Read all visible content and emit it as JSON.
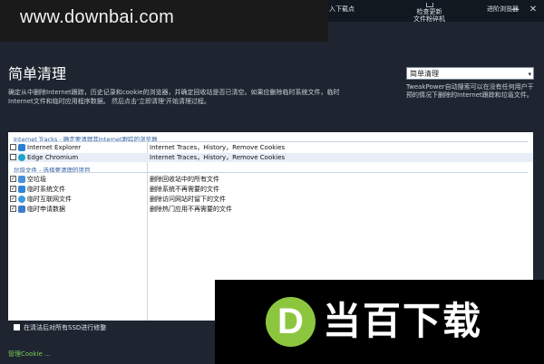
{
  "watermark": "www.downbai.com",
  "titlebar": {
    "partial_label": "入下载点",
    "check_update": "检查更新",
    "file_shredder": "文件粉碎机",
    "advanced_view": "进阶浏览器",
    "minimize": "—",
    "close": "✕"
  },
  "page": {
    "title": "简单清理",
    "description": "确定从中删除Internet跟踪，历史记录和cookie的浏览器，并确定回收站是否已清空。如果应删除临时系统文件，临时Internet文件和临时应用程序数据。 然后点击'立即清理'开始清理过程。"
  },
  "dropdown": {
    "value": "简单清理",
    "arrow": "▾"
  },
  "right_description": "TweakPower自动搜索可以在没有任何用户干预的情况下删除的Internet跟踪和垃圾文件。",
  "list": {
    "groups": [
      {
        "header": "Internet Tracks - 确定要清理其Internet跟踪的浏览器",
        "rows": [
          {
            "name": "Internet Explorer",
            "detail": "Internet Traces，History，Remove Cookies",
            "checked": false,
            "icon": "ie-icon",
            "color": "#2d7fd3"
          },
          {
            "name": "Edge Chromium",
            "detail": "Internet Traces，History，Remove Cookies",
            "checked": false,
            "icon": "edge-icon",
            "color": "#1fa3c8"
          }
        ]
      },
      {
        "header": "垃圾文件 - 选择要清理的项目",
        "rows": [
          {
            "name": "空垃圾",
            "detail": "删除回收站中的所有文件",
            "checked": true,
            "icon": "recycle-bin-icon",
            "color": "#4a90d9"
          },
          {
            "name": "临时系统文件",
            "detail": "删除系统不再需要的文件",
            "checked": true,
            "icon": "windows-icon",
            "color": "#2f86d6"
          },
          {
            "name": "临时互联网文件",
            "detail": "删除访问网站时留下的文件",
            "checked": true,
            "icon": "globe-icon",
            "color": "#3c9ad8"
          },
          {
            "name": "临时申请数据",
            "detail": "删除热门应用不再需要的文件",
            "checked": true,
            "icon": "app-data-icon",
            "color": "#3b7bc8"
          }
        ]
      }
    ]
  },
  "ssd": {
    "label": "在清洁后对所有SSD进行修整",
    "checked": false
  },
  "cookie_link": "管理Cookie ...",
  "logo": {
    "letter": "D",
    "text": "当百下载",
    "color": "#8cc63f"
  }
}
